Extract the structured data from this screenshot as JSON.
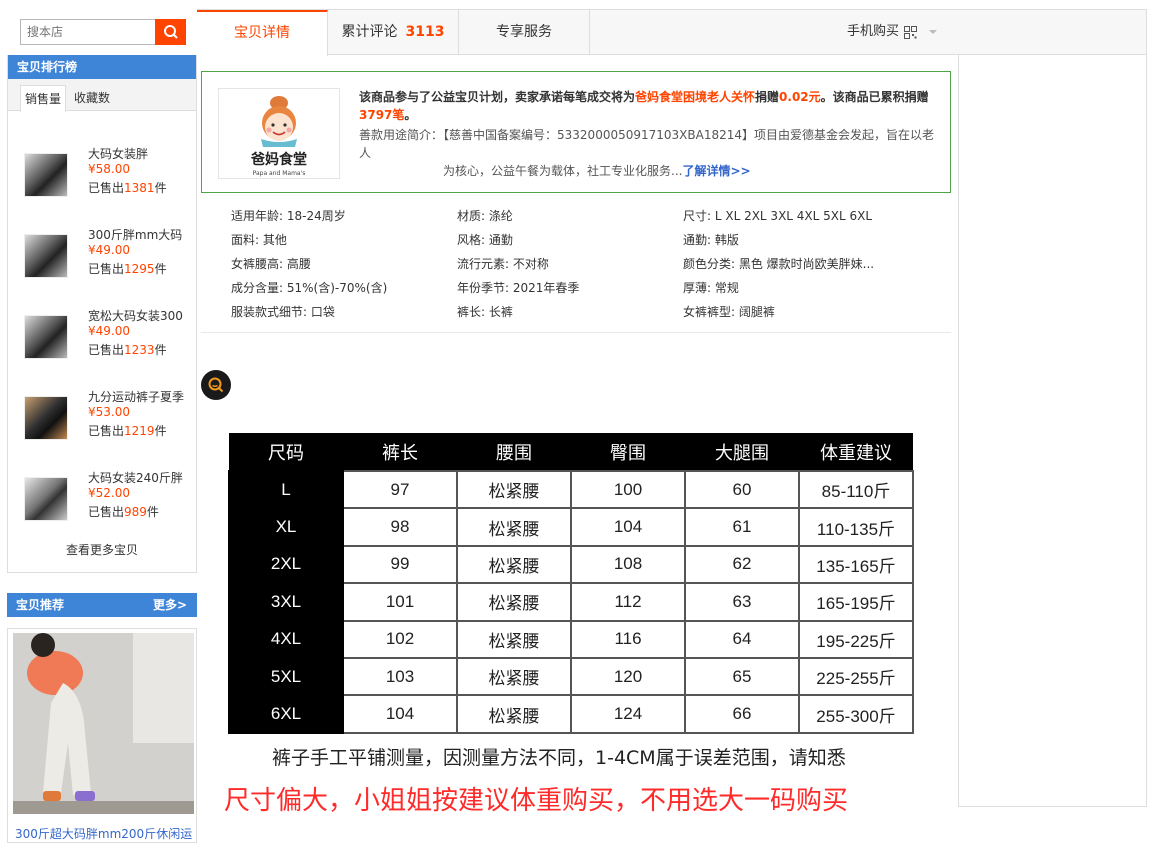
{
  "search": {
    "placeholder": "搜本店"
  },
  "ranking": {
    "title": "宝贝排行榜",
    "tabs": [
      "销售量",
      "收藏数"
    ],
    "items": [
      {
        "name": "大码女装胖",
        "price": "¥58.00",
        "sold_prefix": "已售出",
        "sold": "1381",
        "sold_suffix": "件"
      },
      {
        "name": "300斤胖mm大码",
        "price": "¥49.00",
        "sold_prefix": "已售出",
        "sold": "1295",
        "sold_suffix": "件"
      },
      {
        "name": "宽松大码女装300",
        "price": "¥49.00",
        "sold_prefix": "已售出",
        "sold": "1233",
        "sold_suffix": "件"
      },
      {
        "name": "九分运动裤子夏季",
        "price": "¥53.00",
        "sold_prefix": "已售出",
        "sold": "1219",
        "sold_suffix": "件"
      },
      {
        "name": "大码女装240斤胖",
        "price": "¥52.00",
        "sold_prefix": "已售出",
        "sold": "989",
        "sold_suffix": "件"
      }
    ],
    "more": "查看更多宝贝"
  },
  "recommend": {
    "title": "宝贝推荐",
    "more": "更多>",
    "item_title": "300斤超大码胖mm200斤休闲运"
  },
  "tabs": {
    "detail": "宝贝详情",
    "reviews": "累计评论",
    "review_count": "3113",
    "service": "专享服务",
    "mobile_buy": "手机购买"
  },
  "charity": {
    "lead_1": "该商品参与了公益宝贝计划，卖家承诺每笔成交将为",
    "project": "爸妈食堂困境老人关怀",
    "lead_2": "捐赠",
    "amount": "0.02元",
    "lead_3": "。该商品已累积捐赠",
    "count": "3797笔",
    "lead_4": "。",
    "desc_label": "善款用途简介：",
    "desc_1": "【慈善中国备案编号：5332000050917103XBA18214】项目由爱德基金会发起，旨在以老人",
    "desc_2": "为核心，公益午餐为载体，社工专业化服务...",
    "link": "了解详情>>",
    "logo_cn": "爸妈食堂",
    "logo_en": "Papa and Mama's"
  },
  "attributes": [
    "适用年龄: 18-24周岁",
    "材质: 涤纶",
    "尺寸: L XL 2XL 3XL 4XL 5XL 6XL",
    "面料: 其他",
    "风格: 通勤",
    "通勤: 韩版",
    "女裤腰高: 高腰",
    "流行元素: 不对称",
    "颜色分类: 黑色 爆款时尚欧美胖妹...",
    "成分含量: 51%(含)-70%(含)",
    "年份季节: 2021年春季",
    "厚薄: 常规",
    "服装款式细节: 口袋",
    "裤长: 长裤",
    "女裤裤型: 阔腿裤"
  ],
  "size_chart": {
    "headers": [
      "尺码",
      "裤长",
      "腰围",
      "臀围",
      "大腿围",
      "体重建议"
    ],
    "rows": [
      [
        "L",
        "97",
        "松紧腰",
        "100",
        "60",
        "85-110斤"
      ],
      [
        "XL",
        "98",
        "松紧腰",
        "104",
        "61",
        "110-135斤"
      ],
      [
        "2XL",
        "99",
        "松紧腰",
        "108",
        "62",
        "135-165斤"
      ],
      [
        "3XL",
        "101",
        "松紧腰",
        "112",
        "63",
        "165-195斤"
      ],
      [
        "4XL",
        "102",
        "松紧腰",
        "116",
        "64",
        "195-225斤"
      ],
      [
        "5XL",
        "103",
        "松紧腰",
        "120",
        "65",
        "225-255斤"
      ],
      [
        "6XL",
        "104",
        "松紧腰",
        "124",
        "66",
        "255-300斤"
      ]
    ],
    "note": "裤子手工平铺测量，因测量方法不同，1-4CM属于误差范围，请知悉",
    "warning": "尺寸偏大，小姐姐按建议体重购买，不用选大一码购买"
  },
  "colors": {
    "accent": "#ff4400",
    "panel_blue": "#3e85d8",
    "link_blue": "#3366cc",
    "charity_green": "#4ea64a"
  }
}
